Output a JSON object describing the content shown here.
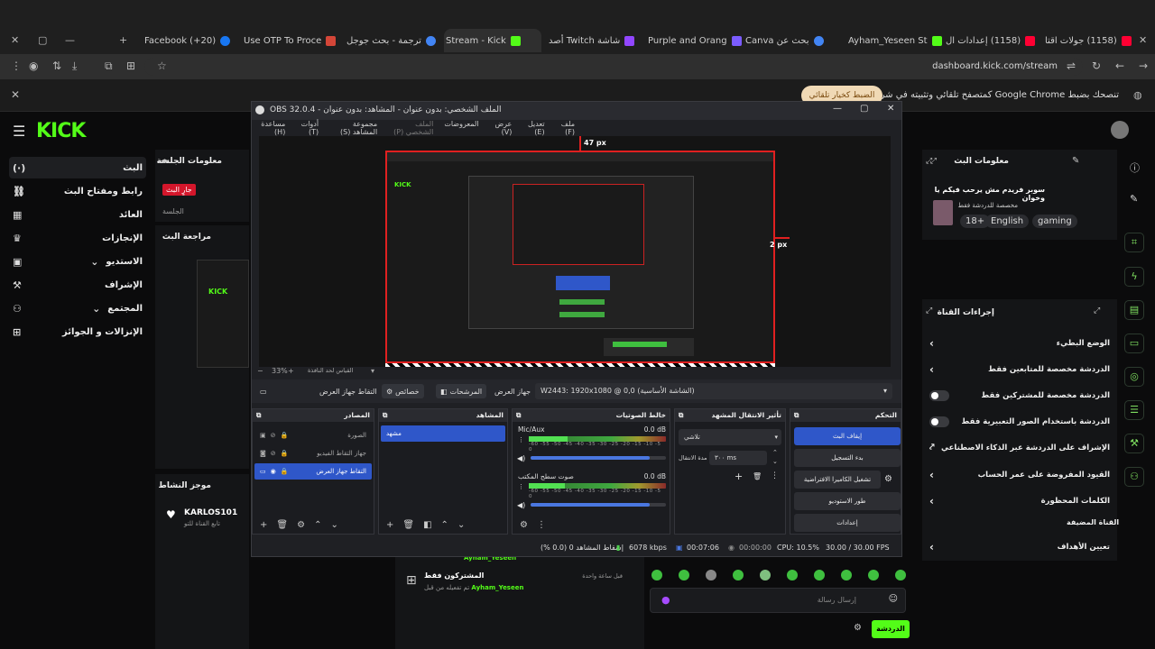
{
  "browser": {
    "tabs": [
      {
        "label": "(1158) جولات اقتا",
        "color": "#ff0033"
      },
      {
        "label": "(1158) إعدادات ال",
        "color": "#ff0033"
      },
      {
        "label": "Ayham_Yeseen St",
        "color": "#53fc18"
      },
      {
        "label": "بحث عن Canva",
        "color": "#4285f4"
      },
      {
        "label": "Purple and Orang",
        "color": "#7b5cff"
      },
      {
        "label": "شاشة Twitch أصد",
        "color": "#9146ff"
      },
      {
        "label": "Stream - Kick",
        "color": "#53fc18"
      },
      {
        "label": "ترجمة - بحث جوجل",
        "color": "#4285f4"
      },
      {
        "label": "Use OTP To Proce",
        "color": "#d44638"
      },
      {
        "label": "(20+) Facebook",
        "color": "#1877f2"
      }
    ],
    "url": "dashboard.kick.com/stream",
    "infobar": {
      "text": "تنصحك بضبط Google Chrome كمتصفح تلقائي وتثبيته في شريط المهام",
      "button": "الضبط كخيار تلقائي"
    }
  },
  "kick": {
    "logo": "KICK",
    "sidebar": [
      {
        "label": "البث",
        "icon": "(·)",
        "active": true
      },
      {
        "label": "رابط ومفتاح البث",
        "icon": "🔗"
      },
      {
        "label": "العائد",
        "icon": "▦"
      },
      {
        "label": "الإنجازات",
        "icon": "🏆"
      },
      {
        "label": "الاستديو",
        "icon": "▣"
      },
      {
        "label": "الإشراف",
        "icon": "🔨"
      },
      {
        "label": "المجتمع",
        "icon": "👥"
      },
      {
        "label": "الإنزالات و الجوائز",
        "icon": "🎁"
      }
    ],
    "session_panel": {
      "title": "معلومات الجلسة",
      "live_badge": "جارٍ البث",
      "session": "الجلسة"
    },
    "review_panel": {
      "title": "مراجعة البث"
    },
    "activity_panel": {
      "title": "موجز النشاط",
      "user": "KARLOS101",
      "subtitle": "تابع القناة للتو"
    },
    "stream_info": {
      "title": "معلومات البث",
      "stream_title": "سوبر فريدم مش يرحب فيكم يا وخوان",
      "chat_mode": "مخصصة للدردشة فقط",
      "tags": [
        "18+",
        "English",
        "gaming"
      ]
    },
    "channel_actions": {
      "title": "إجراءات القناة",
      "rows": [
        {
          "label": "الوضع البطيء",
          "type": "arrow"
        },
        {
          "label": "الدردشة مخصصة للمتابعين فقط",
          "type": "arrow"
        },
        {
          "label": "الدردشة مخصصة للمشتركين فقط",
          "type": "toggle"
        },
        {
          "label": "الدردشة باستخدام الصور التعبيرية فقط",
          "type": "toggle"
        },
        {
          "label": "الإشراف على الدردشة عبر الذكاء الاصطناعي",
          "type": "ext"
        },
        {
          "label": "القيود المفروضة على عمر الحساب",
          "type": "arrow"
        },
        {
          "label": "الكلمات المحظورة",
          "type": "arrow"
        }
      ],
      "pinned_label": "القناة المضيفة",
      "goals_label": "تعيين الأهداف"
    },
    "feed": {
      "row1_user": "Ayham_Yeseen",
      "row2_title": "المشتركون فقط",
      "row2_time": "قبل ساعة واحدة",
      "row2_sub": "تم تفعيله من قبل",
      "row2_user": "Ayham_Yeseen"
    },
    "chat": {
      "placeholder": "إرسال رسالة",
      "send": "الدردشة"
    }
  },
  "obs": {
    "title": "OBS 32.0.4 - الملف الشخصي: بدون عنوان - المشاهد: بدون عنوان",
    "menu": [
      "ملف (F)",
      "تعديل (E)",
      "عرض (V)",
      "المعروضات",
      "الملف الشخصي (P)",
      "مجموعة المشاهد (S)",
      "أدوات (T)",
      "مساعدة (H)"
    ],
    "measure_top": "47 px",
    "measure_right": "2 px",
    "zoom": "33%",
    "zoom_label": "القياس لحد النافذة",
    "toolbar": {
      "source_name": "التقاط جهاز العرض",
      "properties": "خصائص",
      "filters": "المرشحات",
      "display_label": "جهاز العرض",
      "display_value": "W2443: 1920x1080 @ 0,0 (الشاشة الأساسية)"
    },
    "docks": {
      "sources": {
        "title": "المصادر",
        "items": [
          {
            "label": "الصورة"
          },
          {
            "label": "جهاز التقاط الفيديو"
          },
          {
            "label": "التقاط جهاز العرض",
            "selected": true
          }
        ]
      },
      "scenes": {
        "title": "المشاهد",
        "items": [
          "مشهد"
        ]
      },
      "mixer": {
        "title": "خالط الصوتيات",
        "channels": [
          {
            "name": "Mic/Aux",
            "db": "0.0 dB",
            "level": 0.28,
            "volume": 0.88
          },
          {
            "name": "صوت سطح المكتب",
            "db": "0.0 dB",
            "level": 0.26,
            "volume": 0.88
          }
        ],
        "ticks": "-60 -55 -50 -45 -40 -35 -30 -25 -20 -15 -10 -5 0"
      },
      "transitions": {
        "title": "تأثير الانتقال المشهد",
        "type": "تلاشي",
        "duration_label": "مدة الانتقال",
        "duration": "٣٠٠ ms"
      },
      "controls": {
        "title": "التحكم",
        "buttons": [
          "إيقاف البث",
          "بدء التسجيل",
          "تشغيل الكاميرا الافتراضية",
          "طور الاستوديو",
          "إعدادات"
        ]
      }
    },
    "status": {
      "dropped": "إسقاط المشاهد 0 (0.0 %)",
      "bitrate": "6078 kbps",
      "stream_time": "00:07:06",
      "rec_time": "00:00:00",
      "cpu": "CPU: 10.5%",
      "fps": "30.00 / 30.00 FPS"
    }
  }
}
